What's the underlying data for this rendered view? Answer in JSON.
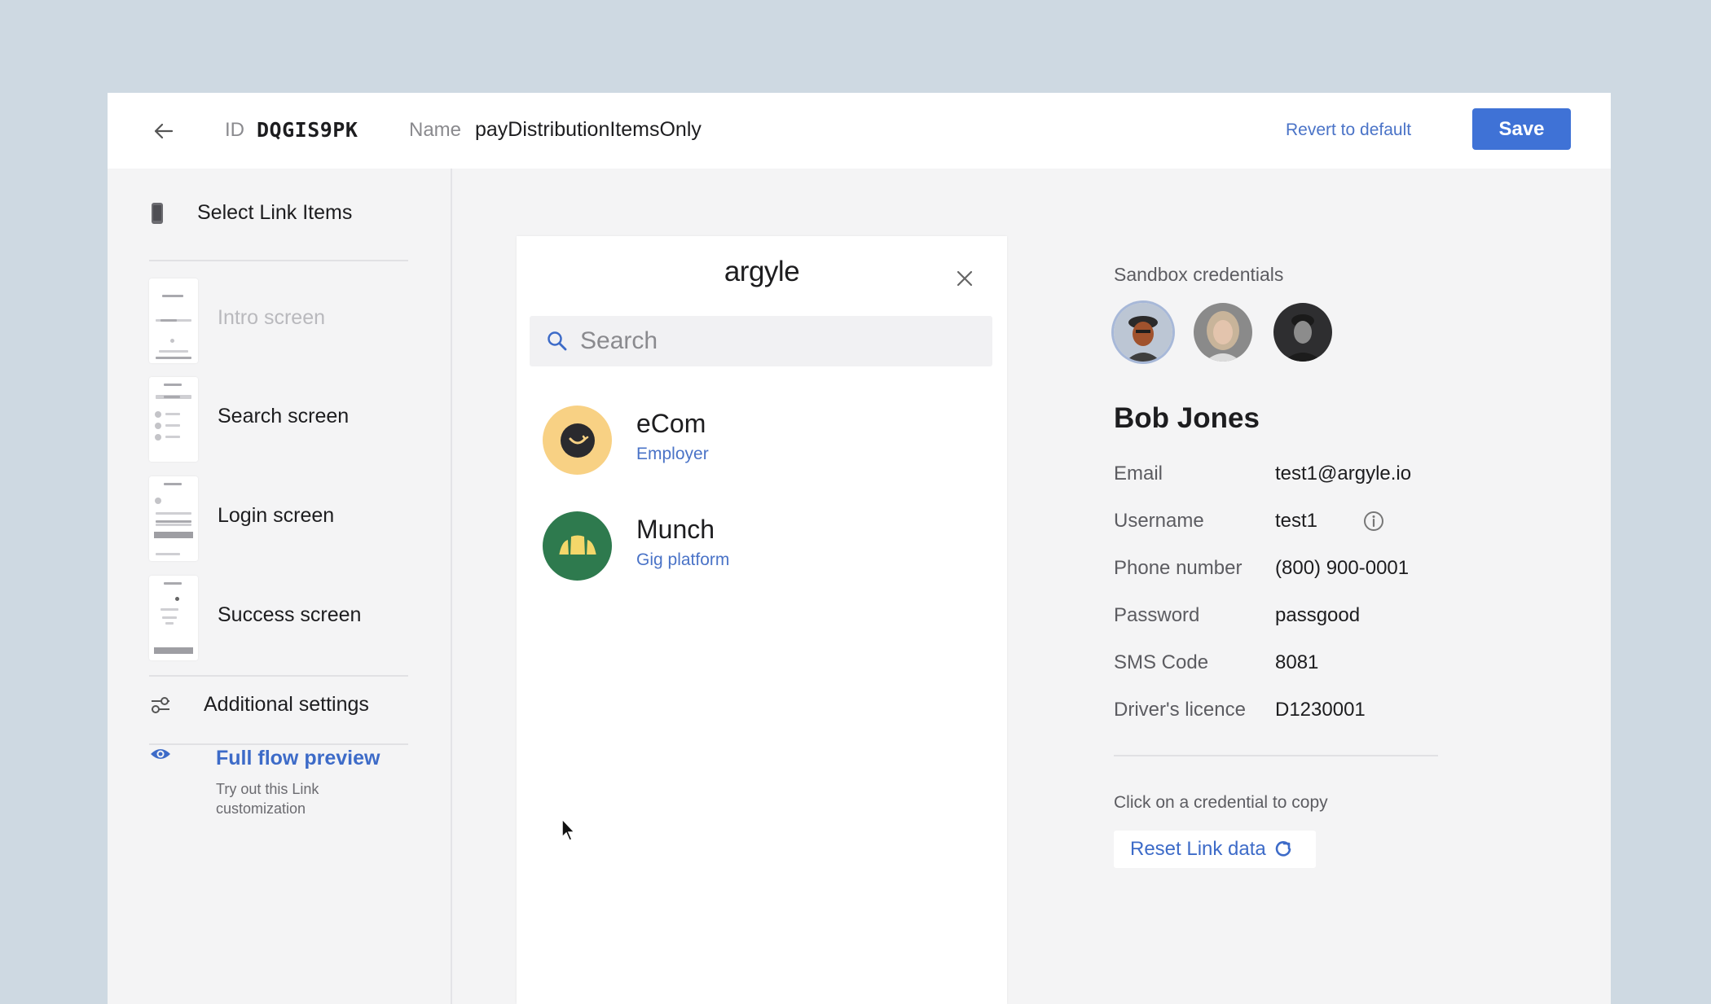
{
  "header": {
    "id_label": "ID",
    "id_value": "DQGIS9PK",
    "name_label": "Name",
    "name_value": "payDistributionItemsOnly",
    "revert_label": "Revert to default",
    "save_label": "Save"
  },
  "sidebar": {
    "title": "Select Link Items",
    "screens": [
      {
        "label": "Intro screen",
        "enabled": false
      },
      {
        "label": "Search screen",
        "enabled": true
      },
      {
        "label": "Login screen",
        "enabled": true
      },
      {
        "label": "Success screen",
        "enabled": true
      }
    ],
    "settings_label": "Additional settings",
    "preview_title": "Full flow preview",
    "preview_subtitle": "Try out this Link customization"
  },
  "link": {
    "logo_text": "argyle",
    "search_placeholder": "Search",
    "companies": [
      {
        "name": "eCom",
        "type": "Employer",
        "color": "#f8d184"
      },
      {
        "name": "Munch",
        "type": "Gig platform",
        "color": "#2e7a4e"
      }
    ]
  },
  "credentials": {
    "title": "Sandbox credentials",
    "selected_user": "Bob Jones",
    "fields": [
      {
        "key": "Email",
        "value": "test1@argyle.io"
      },
      {
        "key": "Username",
        "value": "test1"
      },
      {
        "key": "Phone number",
        "value": "(800) 900-0001"
      },
      {
        "key": "Password",
        "value": "passgood"
      },
      {
        "key": "SMS Code",
        "value": "8081"
      },
      {
        "key": "Driver's licence",
        "value": "D1230001"
      }
    ],
    "hint": "Click on a credential to copy",
    "reset_label": "Reset Link data"
  },
  "colors": {
    "accent": "#3f72d6",
    "link": "#4a73c7",
    "background": "#ced9e2"
  }
}
